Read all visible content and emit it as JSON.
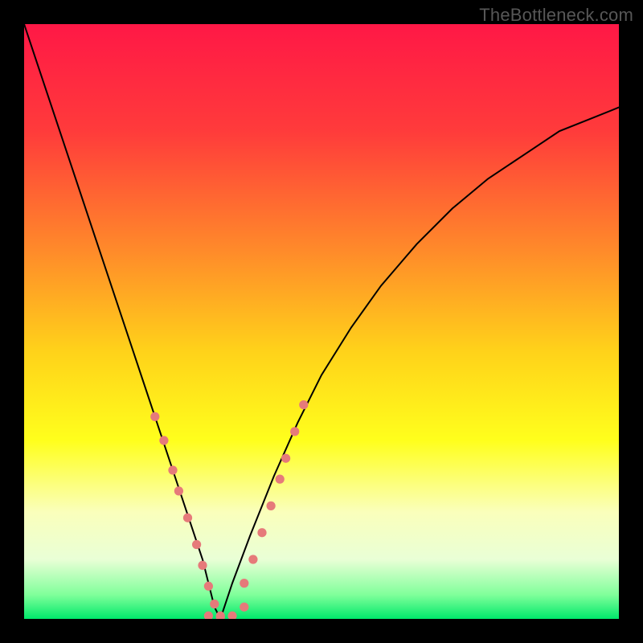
{
  "watermark": "TheBottleneck.com",
  "chart_data": {
    "type": "line",
    "title": "",
    "xlabel": "",
    "ylabel": "",
    "xlim": [
      0,
      100
    ],
    "ylim": [
      0,
      100
    ],
    "gradient_stops": [
      {
        "pos": 0.0,
        "color": "#ff1846"
      },
      {
        "pos": 0.18,
        "color": "#ff3b3b"
      },
      {
        "pos": 0.38,
        "color": "#ff8a2a"
      },
      {
        "pos": 0.55,
        "color": "#ffd21a"
      },
      {
        "pos": 0.7,
        "color": "#ffff1c"
      },
      {
        "pos": 0.82,
        "color": "#faffbb"
      },
      {
        "pos": 0.9,
        "color": "#e9ffd6"
      },
      {
        "pos": 0.96,
        "color": "#7fff9a"
      },
      {
        "pos": 1.0,
        "color": "#00e86b"
      }
    ],
    "series": [
      {
        "name": "left-branch-main",
        "color": "#000000",
        "width": 2,
        "x": [
          0,
          2,
          4,
          6,
          8,
          10,
          12,
          14,
          16,
          18,
          20,
          22,
          24,
          26,
          28,
          30,
          31,
          32,
          33
        ],
        "y": [
          100,
          94,
          88,
          82,
          76,
          70,
          64,
          58,
          52,
          46,
          40,
          34,
          28,
          22,
          16,
          10,
          6,
          2,
          0
        ]
      },
      {
        "name": "right-branch-main",
        "color": "#000000",
        "width": 2,
        "x": [
          33,
          35,
          38,
          42,
          46,
          50,
          55,
          60,
          66,
          72,
          78,
          84,
          90,
          95,
          100
        ],
        "y": [
          0,
          6,
          14,
          24,
          33,
          41,
          49,
          56,
          63,
          69,
          74,
          78,
          82,
          84,
          86
        ]
      },
      {
        "name": "left-branch-dotted-overlay",
        "color": "#e67a7a",
        "style": "dotted",
        "width": 9,
        "x": [
          22,
          23.5,
          25,
          26,
          27.5,
          29,
          30,
          31,
          32,
          33
        ],
        "y": [
          34,
          30,
          25,
          21.5,
          17,
          12.5,
          9,
          5.5,
          2.5,
          0.5
        ]
      },
      {
        "name": "valley-dotted-overlay",
        "color": "#e67a7a",
        "style": "dotted",
        "width": 9,
        "x": [
          31,
          33,
          35,
          37
        ],
        "y": [
          0.5,
          0.3,
          0.5,
          2
        ]
      },
      {
        "name": "right-branch-dotted-overlay",
        "color": "#e67a7a",
        "style": "dotted",
        "width": 9,
        "x": [
          37,
          38.5,
          40,
          41.5,
          43,
          44,
          45.5,
          47
        ],
        "y": [
          6,
          10,
          14.5,
          19,
          23.5,
          27,
          31.5,
          36
        ]
      }
    ]
  }
}
